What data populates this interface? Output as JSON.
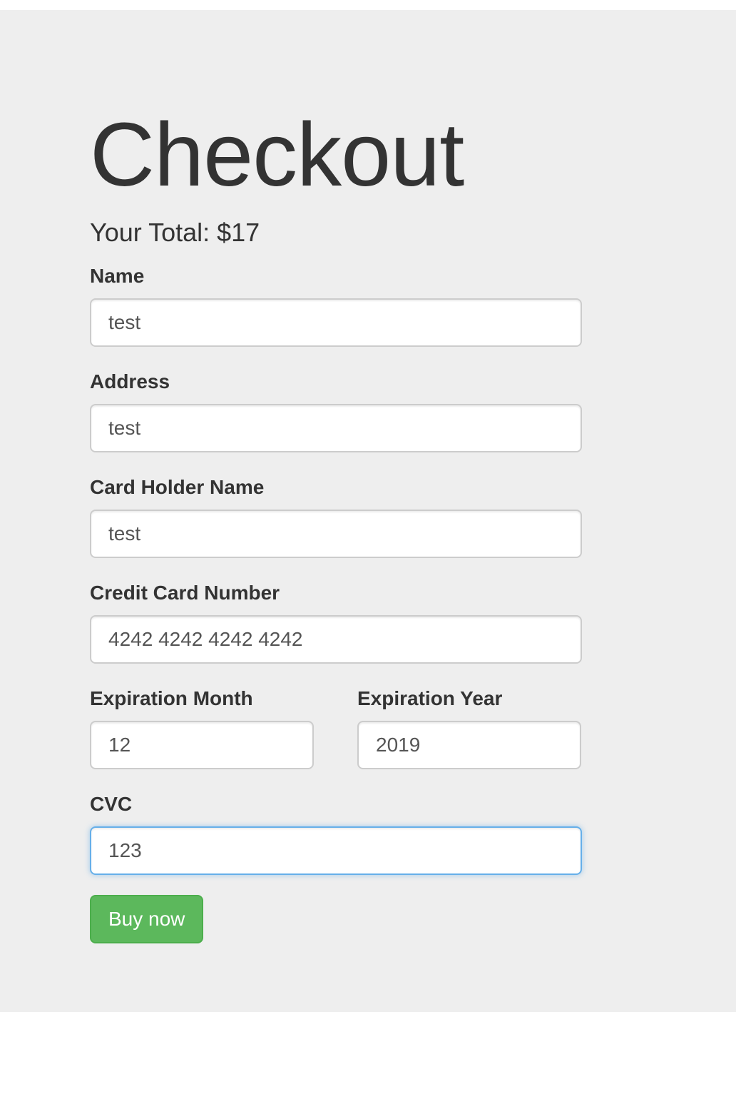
{
  "page": {
    "title": "Checkout",
    "total_text": "Your Total: $17"
  },
  "form": {
    "name": {
      "label": "Name",
      "value": "test"
    },
    "address": {
      "label": "Address",
      "value": "test"
    },
    "card_holder": {
      "label": "Card Holder Name",
      "value": "test"
    },
    "card_number": {
      "label": "Credit Card Number",
      "value": "4242 4242 4242 4242"
    },
    "exp_month": {
      "label": "Expiration Month",
      "value": "12"
    },
    "exp_year": {
      "label": "Expiration Year",
      "value": "2019"
    },
    "cvc": {
      "label": "CVC",
      "value": "123",
      "focused": true
    },
    "submit_label": "Buy now"
  },
  "colors": {
    "background": "#eeeeee",
    "button": "#5cb85c",
    "focus_border": "#66afe9",
    "text": "#333333"
  }
}
